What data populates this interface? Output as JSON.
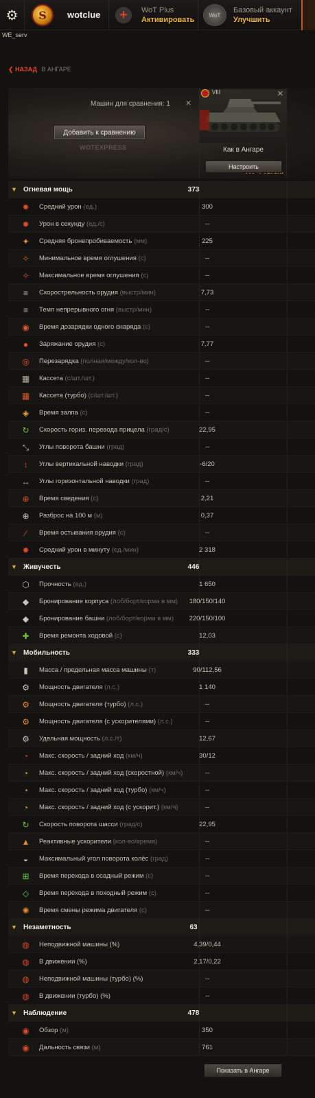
{
  "topbar": {
    "username": "wotclue",
    "wotplus_title": "WoT Plus",
    "wotplus_action": "Активировать",
    "account_title": "Базовый аккаунт",
    "account_action": "Улучшить",
    "server": "WE_serv"
  },
  "nav": {
    "back_label": "НАЗАД",
    "location_label": "В АНГАРЕ"
  },
  "compare": {
    "count_label": "Машин для сравнения: 1",
    "add_button": "Добавить к сравнению",
    "watermark": "WOTEXPRESS"
  },
  "vehicle": {
    "tier": "VIII",
    "name": "KV-4 Turch.",
    "config_label": "Как в Ангаре",
    "setup_button": "Настроить"
  },
  "icons": {
    "firepower": [
      "burst-icon",
      "fire-rate-icon",
      "penetration-icon",
      "stun-min-icon",
      "stun-max-icon",
      "rate-of-fire-icon",
      "continuous-fire-icon",
      "shell-reload-icon",
      "loading-icon",
      "reload-icon",
      "clip-icon",
      "clip-turbo-icon",
      "salvo-icon",
      "traverse-icon",
      "turret-angles-icon",
      "vertical-angles-icon",
      "horizontal-angles-icon",
      "aim-time-icon",
      "dispersion-icon",
      "cooldown-icon",
      "dpm-icon"
    ],
    "survivability": [
      "hp-icon",
      "hull-armor-icon",
      "turret-armor-icon",
      "repair-icon"
    ],
    "mobility": [
      "weight-icon",
      "engine-icon",
      "engine-turbo-icon",
      "engine-boost-icon",
      "power-ratio-icon",
      "speed-icon",
      "speed-fast-icon",
      "speed-turbo-icon",
      "speed-boost-icon",
      "hull-traverse-icon",
      "rocket-boosters-icon",
      "wheel-angle-icon",
      "siege-mode-icon",
      "travel-mode-icon",
      "engine-mode-icon"
    ],
    "concealment": [
      "camo-static-icon",
      "camo-moving-icon",
      "camo-static-turbo-icon",
      "camo-moving-turbo-icon"
    ],
    "spotting": [
      "view-range-icon",
      "radio-range-icon"
    ]
  },
  "sections": [
    {
      "title": "Огневая мощь",
      "value": "373",
      "rows": [
        {
          "label": "Средний урон",
          "unit": "(ед.)",
          "value": "300"
        },
        {
          "label": "Урон в секунду",
          "unit": "(ед./с)",
          "value": "--"
        },
        {
          "label": "Средняя бронепробиваемость",
          "unit": "(мм)",
          "value": "225"
        },
        {
          "label": "Минимальное время оглушения",
          "unit": "(с)",
          "value": "--"
        },
        {
          "label": "Максимальное время оглушения",
          "unit": "(с)",
          "value": "--"
        },
        {
          "label": "Скорострельность орудия",
          "unit": "(выстр/мин)",
          "value": "7,73"
        },
        {
          "label": "Темп непрерывного огня",
          "unit": "(выстр/мин)",
          "value": "--"
        },
        {
          "label": "Время дозарядки одного снаряда",
          "unit": "(с)",
          "value": "--"
        },
        {
          "label": "Заряжание орудия",
          "unit": "(с)",
          "value": "7,77"
        },
        {
          "label": "Перезарядка",
          "unit": "(полная/между/кол-во)",
          "value": "--"
        },
        {
          "label": "Кассета",
          "unit": "(с/шт./шт.)",
          "value": "--"
        },
        {
          "label": "Кассета (турбо)",
          "unit": "(с/шт./шт.)",
          "value": "--"
        },
        {
          "label": "Время залпа",
          "unit": "(с)",
          "value": "--"
        },
        {
          "label": "Скорость гориз. перевода прицела",
          "unit": "(град/с)",
          "value": "22,95"
        },
        {
          "label": "Углы поворота башни",
          "unit": "(град)",
          "value": "--"
        },
        {
          "label": "Углы вертикальной наводки",
          "unit": "(град)",
          "value": "-6/20"
        },
        {
          "label": "Углы горизонтальной наводки",
          "unit": "(град)",
          "value": "--"
        },
        {
          "label": "Время сведения",
          "unit": "(с)",
          "value": "2,21"
        },
        {
          "label": "Разброс на 100 м",
          "unit": "(м)",
          "value": "0,37"
        },
        {
          "label": "Время остывания орудия",
          "unit": "(с)",
          "value": "--"
        },
        {
          "label": "Средний урон в минуту",
          "unit": "(ед./мин)",
          "value": "2 318"
        }
      ]
    },
    {
      "title": "Живучесть",
      "value": "446",
      "rows": [
        {
          "label": "Прочность",
          "unit": "(ед.)",
          "value": "1 650"
        },
        {
          "label": "Бронирование корпуса",
          "unit": "(лоб/борт/корма в мм)",
          "value": "180/150/140"
        },
        {
          "label": "Бронирование башни",
          "unit": "(лоб/борт/корма в мм)",
          "value": "220/150/100"
        },
        {
          "label": "Время ремонта ходовой",
          "unit": "(с)",
          "value": "12,03"
        }
      ]
    },
    {
      "title": "Мобильность",
      "value": "333",
      "rows": [
        {
          "label": "Масса / предельная масса машины",
          "unit": "(т)",
          "value": "90/112,56"
        },
        {
          "label": "Мощность двигателя",
          "unit": "(л.с.)",
          "value": "1 140"
        },
        {
          "label": "Мощность двигателя (турбо)",
          "unit": "(л.с.)",
          "value": "--"
        },
        {
          "label": "Мощность двигателя (с ускорителями)",
          "unit": "(л.с.)",
          "value": "--"
        },
        {
          "label": "Удельная мощность",
          "unit": "(л.с./т)",
          "value": "12,67"
        },
        {
          "label": "Макс. скорость / задний ход",
          "unit": "(км/ч)",
          "value": "30/12"
        },
        {
          "label": "Макс. скорость / задний ход (скоростной)",
          "unit": "(км/ч)",
          "value": "--"
        },
        {
          "label": "Макс. скорость / задний ход (турбо)",
          "unit": "(км/ч)",
          "value": "--"
        },
        {
          "label": "Макс. скорость / задний ход (с ускорит.)",
          "unit": "(км/ч)",
          "value": "--"
        },
        {
          "label": "Скорость поворота шасси",
          "unit": "(град/с)",
          "value": "22,95"
        },
        {
          "label": "Реактивные ускорители",
          "unit": "(кол-во/время)",
          "value": "--"
        },
        {
          "label": "Максимальный угол поворота колёс",
          "unit": "(град)",
          "value": "--"
        },
        {
          "label": "Время перехода в осадный режим",
          "unit": " (с)",
          "value": "--"
        },
        {
          "label": "Время перехода в походный режим",
          "unit": " (с)",
          "value": "--"
        },
        {
          "label": "Время смены режима двигателя",
          "unit": "(с)",
          "value": "--"
        }
      ]
    },
    {
      "title": "Незаметность",
      "value": "63",
      "rows": [
        {
          "label": "Неподвижной машины (%)",
          "unit": "",
          "value": "4,39/0,44"
        },
        {
          "label": "В движении (%)",
          "unit": "",
          "value": "2,17/0,22"
        },
        {
          "label": "Неподвижной машины (турбо) (%)",
          "unit": "",
          "value": "--"
        },
        {
          "label": "В движении (турбо) (%)",
          "unit": "",
          "value": "--"
        }
      ]
    },
    {
      "title": "Наблюдение",
      "value": "478",
      "rows": [
        {
          "label": "Обзор",
          "unit": "(м)",
          "value": "350"
        },
        {
          "label": "Дальность связи",
          "unit": "(м)",
          "value": "761"
        }
      ]
    }
  ],
  "footer": {
    "show_in_hangar": "Показать в Ангаре"
  }
}
